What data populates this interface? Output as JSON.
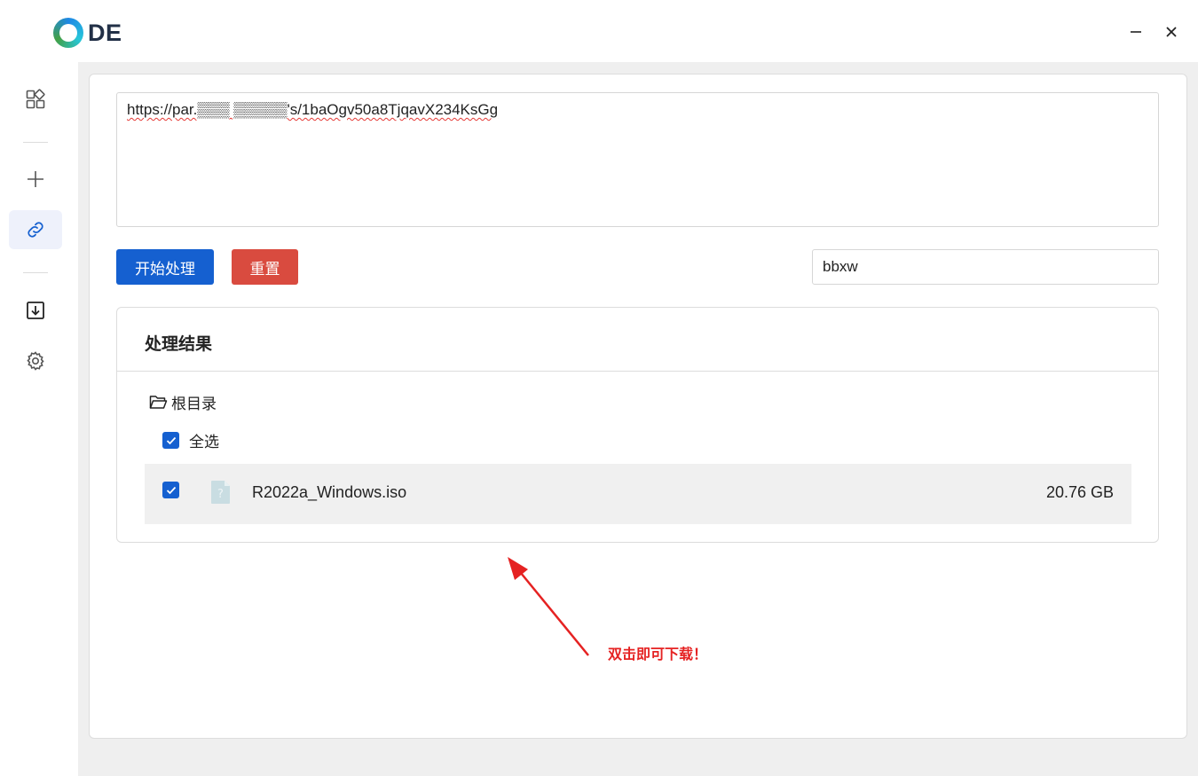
{
  "app": {
    "logo_text": "DE",
    "window_controls": {
      "minimize": "—",
      "close": "✕"
    }
  },
  "sidebar": {
    "items": [
      {
        "icon": "grid-icon"
      },
      {
        "icon": "plus-icon"
      },
      {
        "icon": "link-icon",
        "active": true
      },
      {
        "icon": "download-icon"
      },
      {
        "icon": "gear-icon"
      }
    ]
  },
  "form": {
    "url_value": "https://par.▒▒▒ ▒▒▒▒▒'s/1baOgv50a8TjqavX234KsGg",
    "start_button": "开始处理",
    "reset_button": "重置",
    "password_value": "bbxw"
  },
  "result": {
    "title": "处理结果",
    "root_label": "根目录",
    "select_all_label": "全选",
    "files": [
      {
        "name": "R2022a_Windows.iso",
        "size": "20.76 GB",
        "checked": true,
        "icon": "unknown-file-icon"
      }
    ]
  },
  "annotation": {
    "text": "双击即可下载！",
    "color": "#e52222"
  },
  "colors": {
    "primary": "#1560d0",
    "danger": "#d94b3f",
    "active_bg": "#eef1fb"
  }
}
